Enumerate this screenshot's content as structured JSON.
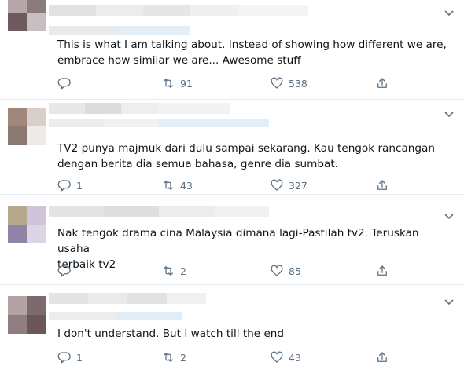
{
  "colors": {
    "icon": "#5b7083",
    "text": "#0f1419",
    "divider": "#e6ecf0"
  },
  "tweets": [
    {
      "text_lines": [
        "This is what I am talking about. Instead of showing how different we are,",
        "embrace how similar we are... Awesome stuff"
      ],
      "reply_count": "",
      "retweet_count": "91",
      "like_count": "538"
    },
    {
      "text_lines": [
        "TV2 punya majmuk dari dulu sampai sekarang. Kau tengok rancangan",
        "dengan berita dia semua bahasa, genre dia sumbat."
      ],
      "reply_count": "1",
      "retweet_count": "43",
      "like_count": "327"
    },
    {
      "text_lines": [
        "Nak tengok drama cina Malaysia dimana lagi-Pastilah tv2. Teruskan usaha",
        "terbaik tv2"
      ],
      "reply_count": "",
      "retweet_count": "2",
      "like_count": "85"
    },
    {
      "text_lines": [
        "I don't understand. But I watch till the end"
      ],
      "reply_count": "1",
      "retweet_count": "2",
      "like_count": "43"
    }
  ],
  "icons": {
    "reply": "reply-icon",
    "retweet": "retweet-icon",
    "like": "like-icon",
    "share": "share-icon",
    "more": "chevron-down-icon"
  }
}
